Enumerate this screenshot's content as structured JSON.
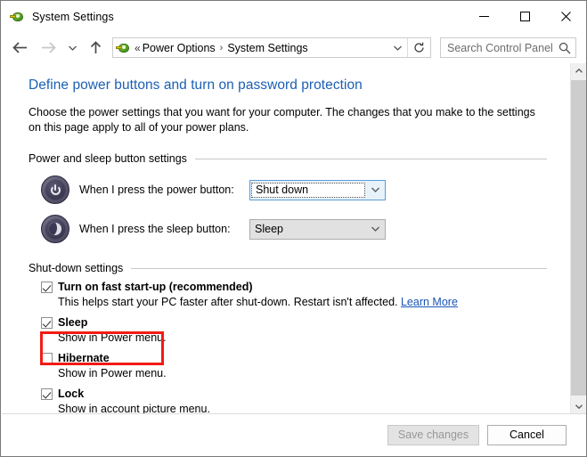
{
  "window": {
    "title": "System Settings",
    "icon": "power-options-icon",
    "caption": {
      "minimize": "minimize-icon",
      "maximize": "maximize-icon",
      "close": "close-icon"
    }
  },
  "navigation": {
    "back": "back-arrow-icon",
    "forward": "forward-arrow-icon",
    "recent": "recent-locations-icon",
    "up": "up-arrow-icon",
    "address": {
      "icon": "power-options-icon",
      "overflow": "«",
      "crumbs": [
        "Power Options",
        "System Settings"
      ],
      "separator": "›",
      "dropdown": "chevron-down-icon",
      "refresh": "refresh-icon"
    },
    "search": {
      "placeholder": "Search Control Panel",
      "value": "",
      "icon": "search-icon"
    }
  },
  "page": {
    "heading": "Define power buttons and turn on password protection",
    "description": "Choose the power settings that you want for your computer. The changes that you make to the settings on this page apply to all of your power plans."
  },
  "power_section": {
    "title": "Power and sleep button settings",
    "rows": [
      {
        "icon": "power-button-icon",
        "label": "When I press the power button:",
        "value": "Shut down",
        "focused": true
      },
      {
        "icon": "sleep-button-icon",
        "label": "When I press the sleep button:",
        "value": "Sleep",
        "focused": false
      }
    ]
  },
  "shutdown_section": {
    "title": "Shut-down settings",
    "items": [
      {
        "label": "Turn on fast start-up (recommended)",
        "checked": true,
        "description": "This helps start your PC faster after shut-down. Restart isn't affected.",
        "link": "Learn More",
        "highlighted": false
      },
      {
        "label": "Sleep",
        "checked": true,
        "description": "Show in Power menu.",
        "link": "",
        "highlighted": false
      },
      {
        "label": "Hibernate",
        "checked": false,
        "description": "Show in Power menu.",
        "link": "",
        "highlighted": true
      },
      {
        "label": "Lock",
        "checked": true,
        "description": "Show in account picture menu.",
        "link": "",
        "highlighted": false
      }
    ]
  },
  "scrollbar": {
    "up": "scroll-up-icon",
    "down": "scroll-down-icon"
  },
  "footer": {
    "save_label": "Save changes",
    "save_disabled": true,
    "cancel_label": "Cancel"
  },
  "colors": {
    "heading": "#1b5fb5",
    "link": "#1a55b5",
    "annotation": "#f31b15",
    "focus_border": "#5b9dd9"
  }
}
